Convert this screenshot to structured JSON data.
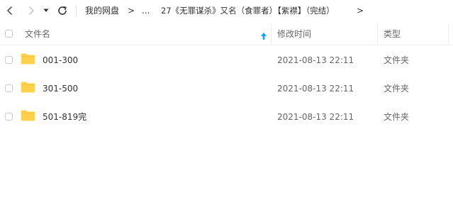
{
  "toolbar": {
    "breadcrumb": {
      "root": "我的网盘",
      "ellipsis": "...",
      "current": "27《无罪谋杀》又名（食罪者）【紫襟】（完结）",
      "separator": ">"
    }
  },
  "table": {
    "columns": {
      "name": "文件名",
      "modified": "修改时间",
      "type": "类型"
    },
    "rows": [
      {
        "name": "001-300",
        "modified": "2021-08-13 22:11",
        "type": "文件夹"
      },
      {
        "name": "301-500",
        "modified": "2021-08-13 22:11",
        "type": "文件夹"
      },
      {
        "name": "501-819完",
        "modified": "2021-08-13 22:11",
        "type": "文件夹"
      }
    ]
  },
  "icons": {
    "back": "chevron-left-icon",
    "forward": "chevron-right-icon",
    "history": "caret-down-icon",
    "refresh": "refresh-icon",
    "folder": "folder-icon",
    "sort": "sort-ascending-icon"
  },
  "colors": {
    "folder": "#FFD04B",
    "sort_arrow": "#06A7FF"
  }
}
